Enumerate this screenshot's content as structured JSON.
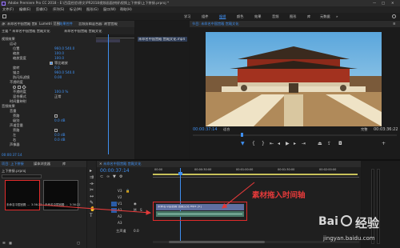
{
  "window": {
    "app_title": "Adobe Premiere Pro CC 2018 - E:\\百度经验\\原文\\PR2018视频画面拼接\\视频上下拼接\\上下拼接.prproj *"
  },
  "menu": [
    "文件(F)",
    "编辑(E)",
    "剪辑(C)",
    "序列(S)",
    "标记(M)",
    "图形(G)",
    "窗口(W)",
    "帮助(H)"
  ],
  "workspaces": [
    "学习",
    "组件",
    "编辑",
    "颜色",
    "效果",
    "音频",
    "图形",
    "库",
    "元数据"
  ],
  "left_panel": {
    "tabs": [
      "源: 未命名中国宫殿 宫殿文化",
      "Lumetri 范围",
      "效果控件",
      "音频剪辑混合器: 故宫宫殿"
    ],
    "source_line": "主要 * 未命名中国宫殿 宫殿文化",
    "seq_line": "未命名中国宫殿 宫殿文化",
    "rows": [
      {
        "label": "视频效果",
        "value": ""
      },
      {
        "label": "运动",
        "value": ""
      },
      {
        "label": "位置",
        "value": "960.0  540.0"
      },
      {
        "label": "缩放",
        "value": "100.0"
      },
      {
        "label": "缩放宽度",
        "value": "100.0"
      },
      {
        "label": "",
        "value": "等比缩放"
      },
      {
        "label": "旋转",
        "value": "0.0"
      },
      {
        "label": "锚点",
        "value": "960.0  540.0"
      },
      {
        "label": "防闪烁滤镜",
        "value": "0.00"
      },
      {
        "label": "不透明度",
        "value": ""
      },
      {
        "label": "",
        "value": ""
      },
      {
        "label": "不透明度",
        "value": "100.0 %"
      },
      {
        "label": "混合模式",
        "value": "正常"
      },
      {
        "label": "时间重映射",
        "value": ""
      },
      {
        "label": "音频效果",
        "value": ""
      },
      {
        "label": "音量",
        "value": ""
      },
      {
        "label": "旁路",
        "value": ""
      },
      {
        "label": "级别",
        "value": "0.0 dB"
      },
      {
        "label": "声道音量",
        "value": ""
      },
      {
        "label": "旁路",
        "value": ""
      },
      {
        "label": "左",
        "value": "0.0 dB"
      },
      {
        "label": "右",
        "value": "0.0 dB"
      },
      {
        "label": "声像器",
        "value": ""
      }
    ],
    "timecode": "00:00:37:14"
  },
  "source_list_item": "未命名中国宫殿 宫殿文化.mp4",
  "program_monitor": {
    "tab": "节目: 未命名中国宫殿 宫殿文化",
    "timecode_left": "00:00:37:14",
    "fit_label": "适合",
    "quality": "完整",
    "timecode_right": "00:03:36:22"
  },
  "project_panel": {
    "tabs": [
      "项目: 上下拼接",
      "媒体浏览器",
      "库"
    ],
    "path": "上下拼接.prproj",
    "items": [
      {
        "name": "未命名中国宫殿 ...",
        "duration": "3:36:22"
      },
      {
        "name": "未命名中国宫殿 ...",
        "duration": "3:36:22"
      }
    ]
  },
  "timeline": {
    "tab": "未命名中国宫殿 宫殿文化",
    "timecode": "00:00:37:14",
    "ruler": [
      "00:00",
      "00:00:30:00",
      "00:01:00:00",
      "00:01:30:00",
      "00:02:00:00"
    ],
    "tracks": [
      "V3",
      "V2",
      "V1",
      "A1",
      "A2",
      "A3",
      "主声道"
    ],
    "master_value": "0.0",
    "clip_video": "未命名中国宫殿 宫殿文化.mp4 [V]",
    "clip_audio": ""
  },
  "annotation": "素材拖入时间轴",
  "watermark": {
    "brand": "Bai",
    "chinese": "经验",
    "url": "jingyan.baidu.com"
  },
  "colors": {
    "accent_blue": "#3f8ff0",
    "annotation_red": "#e43a3a",
    "clip_video": "#5f6fa0"
  }
}
